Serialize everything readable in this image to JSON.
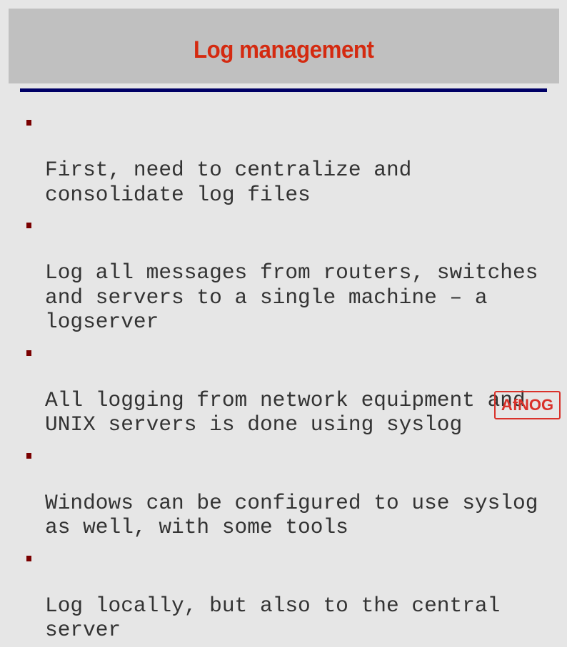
{
  "slide": {
    "title": "Log management",
    "colors": {
      "background": "#e6e6e6",
      "title_box": "#c0c0c0",
      "title_text": "#d42a10",
      "rule": "#000066",
      "bullet": "#7a0000",
      "logo": "#d9312a"
    },
    "bullets": [
      {
        "text": "First, need to centralize and\nconsolidate log files"
      },
      {
        "text": "Log all messages from routers, switches\nand servers to a single machine – a\nlogserver"
      },
      {
        "text": "All logging from network equipment and\nUNIX servers is done using syslog"
      },
      {
        "text": "Windows can be configured to use syslog\nas well, with some tools"
      },
      {
        "text": "Log locally, but also to the central\nserver"
      }
    ],
    "logo": {
      "text": "AfNOG",
      "icon": "afnog-logo-icon"
    }
  }
}
